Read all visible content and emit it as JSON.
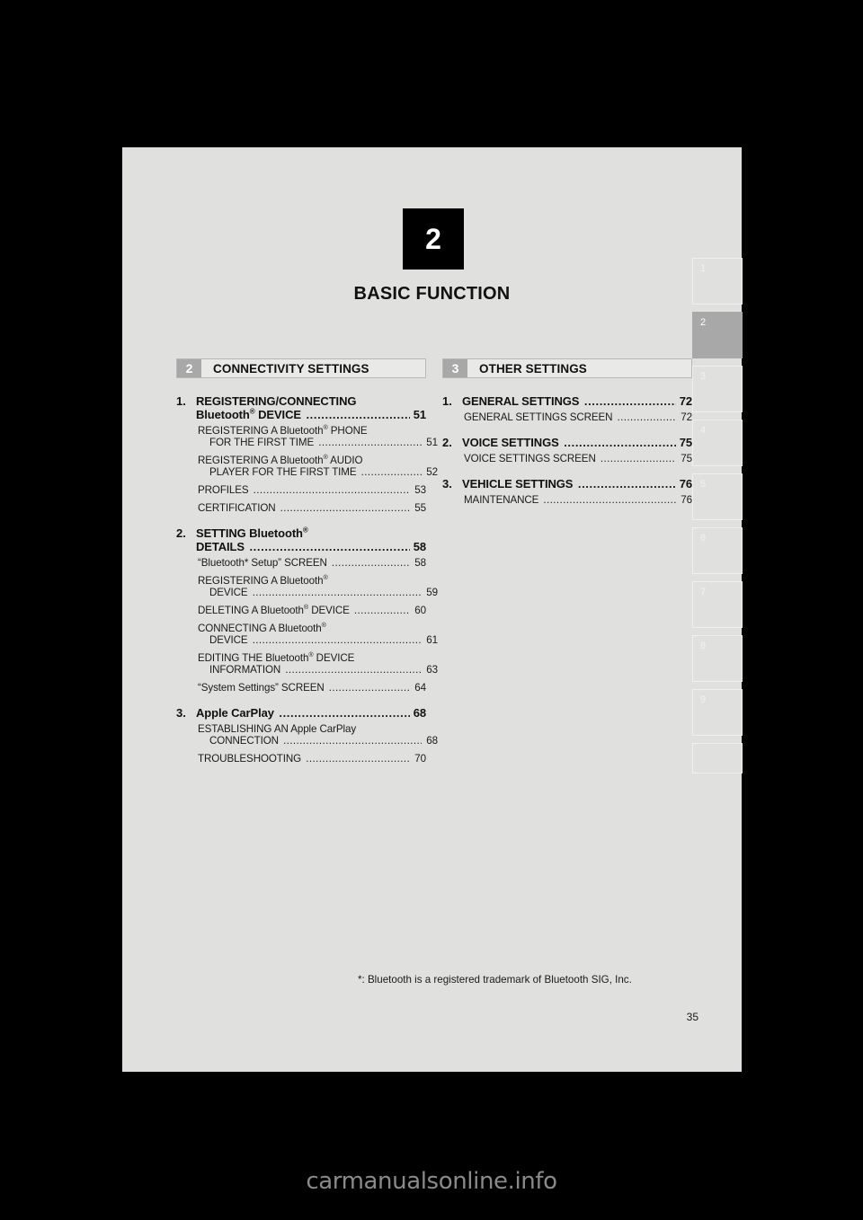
{
  "chapter": {
    "number": "2",
    "title": "BASIC FUNCTION"
  },
  "sections": [
    {
      "number": "2",
      "title": "CONNECTIVITY SETTINGS",
      "entries": [
        {
          "index": "1.",
          "lines": [
            "REGISTERING/CONNECTING",
            "Bluetooth® DEVICE"
          ],
          "page": "51",
          "level": "major",
          "children": [
            {
              "lines": [
                "REGISTERING A Bluetooth® PHONE",
                "FOR THE FIRST TIME"
              ],
              "page": "51"
            },
            {
              "lines": [
                "REGISTERING A Bluetooth® AUDIO",
                "PLAYER FOR THE FIRST TIME"
              ],
              "page": "52"
            },
            {
              "lines": [
                "PROFILES"
              ],
              "page": "53"
            },
            {
              "lines": [
                "CERTIFICATION"
              ],
              "page": "55"
            }
          ]
        },
        {
          "index": "2.",
          "lines": [
            "SETTING Bluetooth®",
            "DETAILS"
          ],
          "page": "58",
          "level": "major",
          "children": [
            {
              "lines": [
                "“Bluetooth* Setup” SCREEN"
              ],
              "page": "58"
            },
            {
              "lines": [
                "REGISTERING A Bluetooth®",
                "DEVICE"
              ],
              "page": "59"
            },
            {
              "lines": [
                "DELETING A Bluetooth® DEVICE"
              ],
              "page": "60"
            },
            {
              "lines": [
                "CONNECTING A Bluetooth®",
                "DEVICE"
              ],
              "page": "61"
            },
            {
              "lines": [
                "EDITING THE Bluetooth® DEVICE",
                "INFORMATION"
              ],
              "page": "63"
            },
            {
              "lines": [
                "“System Settings” SCREEN"
              ],
              "page": "64"
            }
          ]
        },
        {
          "index": "3.",
          "lines": [
            "Apple CarPlay"
          ],
          "page": "68",
          "level": "major",
          "children": [
            {
              "lines": [
                "ESTABLISHING AN Apple CarPlay",
                "CONNECTION"
              ],
              "page": "68"
            },
            {
              "lines": [
                "TROUBLESHOOTING"
              ],
              "page": "70"
            }
          ]
        }
      ]
    },
    {
      "number": "3",
      "title": "OTHER SETTINGS",
      "entries": [
        {
          "index": "1.",
          "lines": [
            "GENERAL SETTINGS"
          ],
          "page": "72",
          "level": "major",
          "children": [
            {
              "lines": [
                "GENERAL SETTINGS SCREEN"
              ],
              "page": "72"
            }
          ]
        },
        {
          "index": "2.",
          "lines": [
            "VOICE SETTINGS"
          ],
          "page": "75",
          "level": "major",
          "children": [
            {
              "lines": [
                "VOICE SETTINGS SCREEN"
              ],
              "page": "75"
            }
          ]
        },
        {
          "index": "3.",
          "lines": [
            "VEHICLE SETTINGS"
          ],
          "page": "76",
          "level": "major",
          "children": [
            {
              "lines": [
                "MAINTENANCE"
              ],
              "page": "76"
            }
          ]
        }
      ]
    }
  ],
  "footnote": "*: Bluetooth is a registered trademark of Bluetooth SIG, Inc.",
  "page_number": "35",
  "tab_strip": {
    "tabs": [
      "1",
      "2",
      "3",
      "4",
      "5",
      "6",
      "7",
      "8",
      "9",
      ""
    ],
    "active": "2"
  },
  "watermark": "carmanualsonline.info",
  "colors": {
    "page_background": "#e0e0de",
    "outside_background": "#000000",
    "badge_background": "#000000",
    "section_number_background": "#a8a8a8",
    "section_bar_background": "#e9e9e7",
    "active_tab_background": "#a8a8a8",
    "text": "#111111",
    "watermark": "#8a8a8a"
  }
}
